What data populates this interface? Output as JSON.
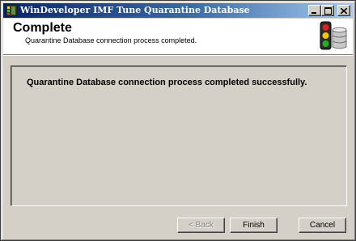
{
  "window": {
    "title": "WinDeveloper IMF Tune Quarantine Database",
    "icon": "app-icon",
    "controls": {
      "minimize": "minimize-icon",
      "maximize": "maximize-icon",
      "close": "close-icon"
    }
  },
  "header": {
    "title": "Complete",
    "subtitle": "Quarantine Database connection process completed.",
    "icon": "traffic-light-database-icon"
  },
  "content": {
    "message": "Quarantine Database connection process completed successfully."
  },
  "buttons": {
    "back": "< Back",
    "back_enabled": false,
    "finish": "Finish",
    "cancel": "Cancel"
  },
  "colors": {
    "titlebar_start": "#0a246a",
    "titlebar_end": "#a6caf0",
    "face": "#d4d0c8",
    "header_bg": "#ffffff"
  }
}
